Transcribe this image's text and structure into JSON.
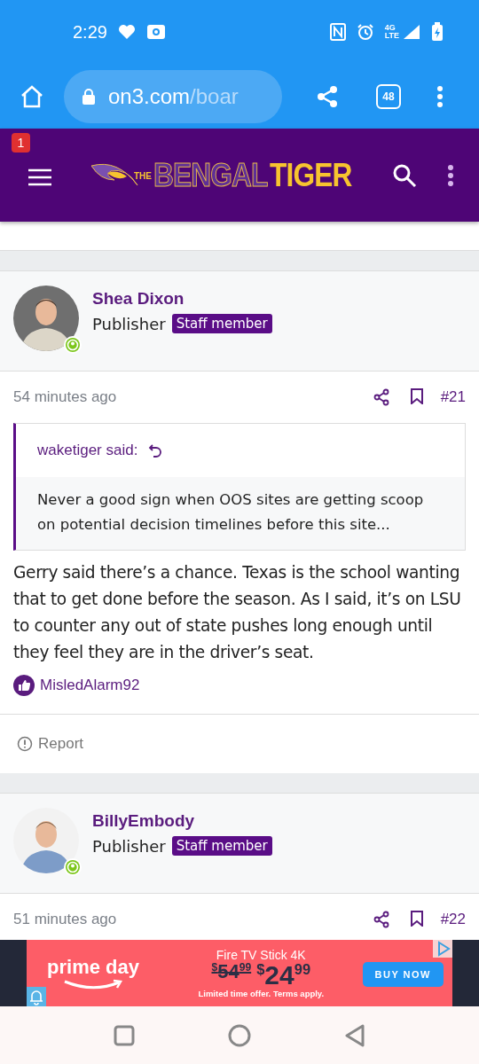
{
  "status_bar": {
    "time": "2:29",
    "network": "4G\nLTE"
  },
  "browser": {
    "url_host": "on3.com",
    "url_path": "/boar",
    "tab_count": "48"
  },
  "site_header": {
    "notification_count": "1",
    "logo_small": "THE",
    "logo_left": "BENGAL",
    "logo_right": "TIGER"
  },
  "posts": [
    {
      "author": "Shea Dixon",
      "role": "Publisher",
      "badge": "Staff member",
      "online": true,
      "time": "54 minutes ago",
      "number": "#21",
      "quote": {
        "author": "waketiger said:",
        "text": "Never a good sign when OOS sites are getting scoop on potential decision timelines before this site..."
      },
      "body": "Gerry said there’s a chance. Texas is the school wanting that to get done before the season. As I said, it’s on LSU to counter any out of state pushes long enough until they feel they are in the driver’s seat.",
      "reactions": "MisledAlarm92",
      "report": "Report"
    },
    {
      "author": "BillyEmbody",
      "role": "Publisher",
      "badge": "Staff member",
      "online": true,
      "time": "51 minutes ago",
      "number": "#22"
    }
  ],
  "ad": {
    "brand": "prime day",
    "product": "Fire TV Stick 4K",
    "old_price": {
      "currency": "$",
      "whole": "54",
      "cents": "99"
    },
    "new_price": {
      "currency": "$",
      "whole": "24",
      "cents": "99"
    },
    "fine_print": "Limited time offer. Terms apply.",
    "button": "BUY NOW"
  }
}
